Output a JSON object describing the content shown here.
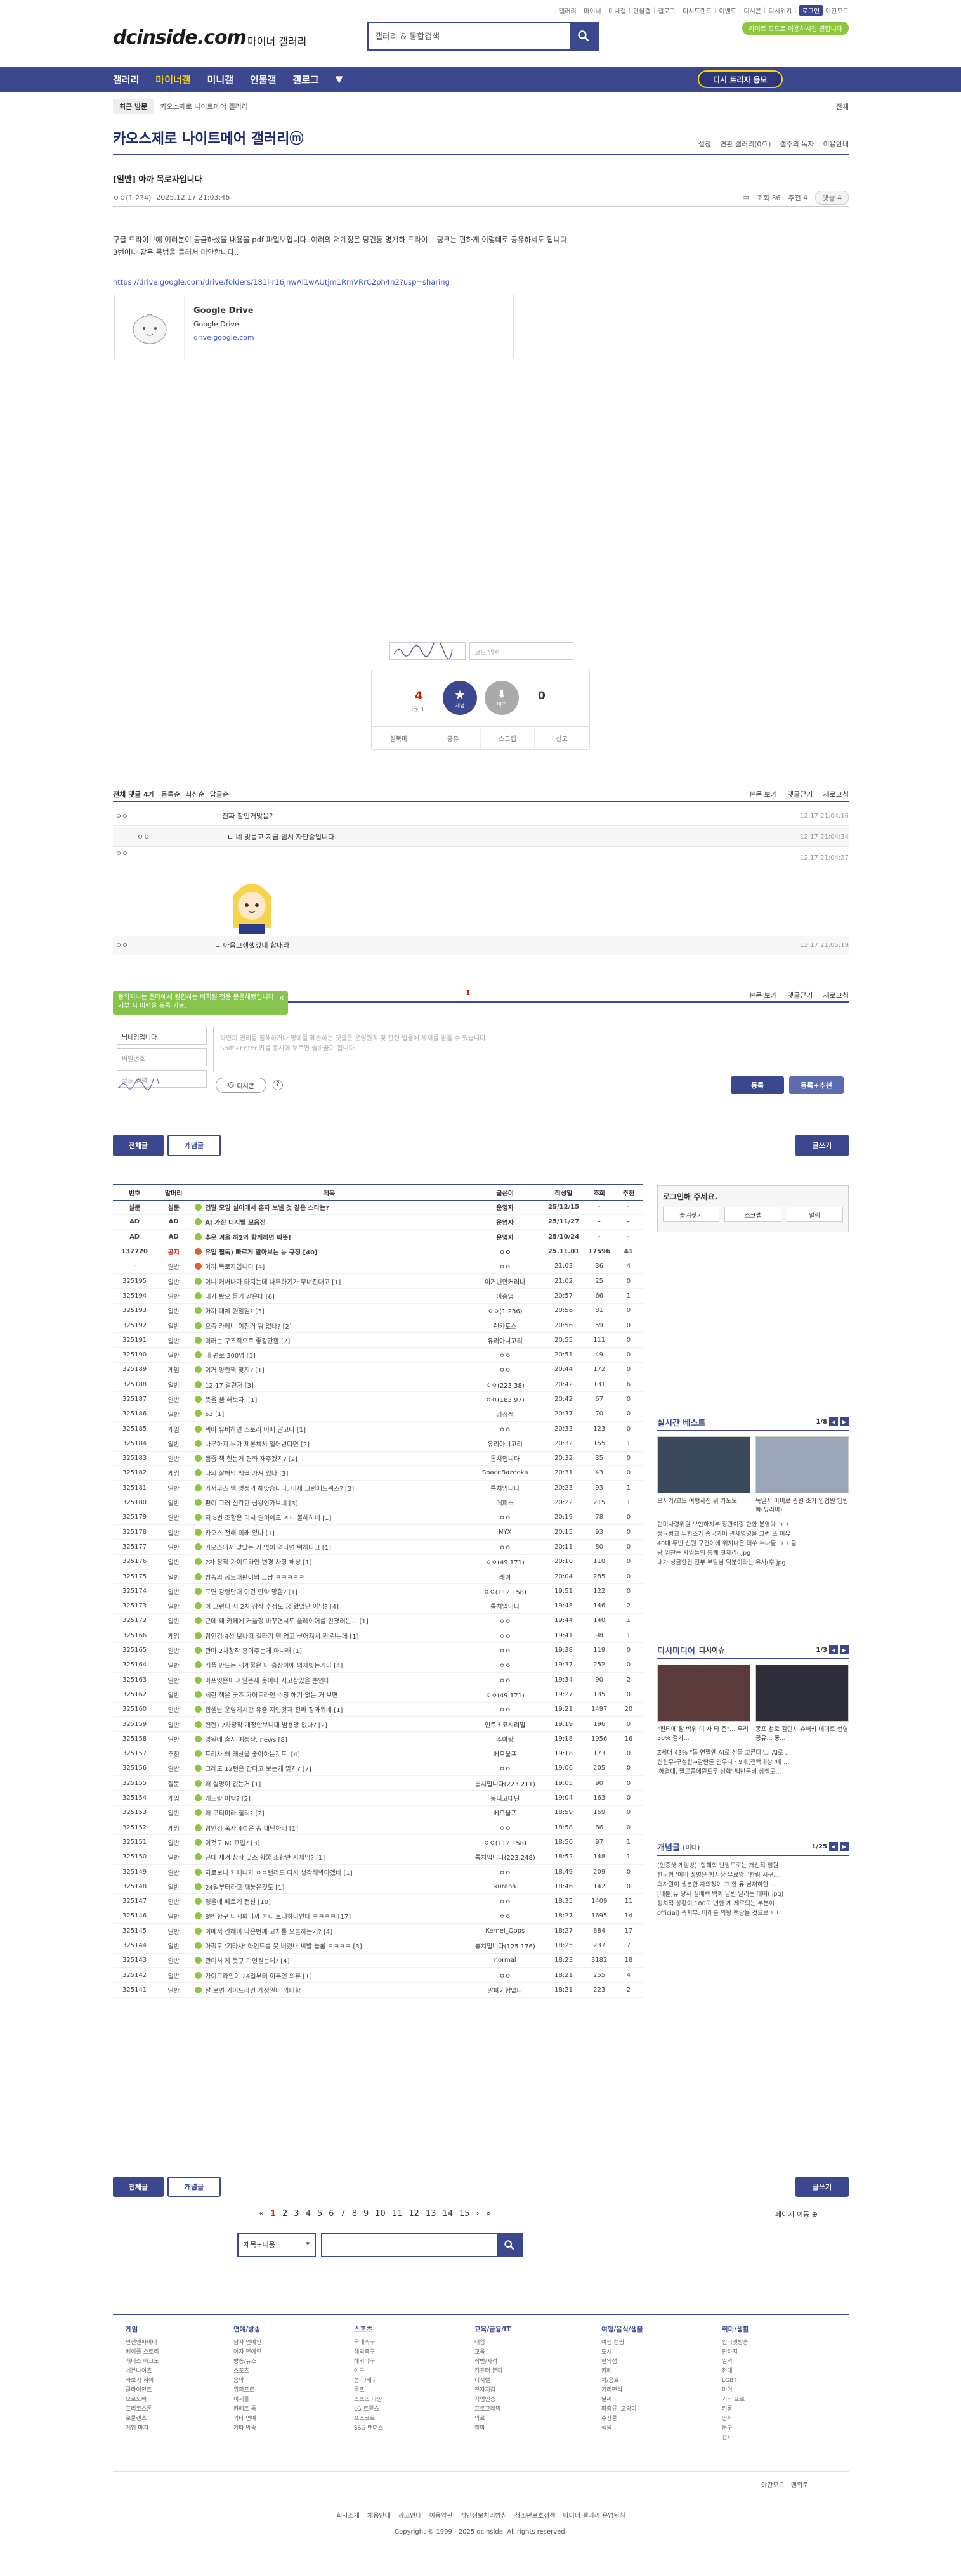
{
  "util": {
    "links": [
      "갤러리",
      "마이너",
      "미니갤",
      "인물갤",
      "갤로그",
      "디시트렌드",
      "이벤트",
      "디시콘",
      "디시위키"
    ],
    "login": "로그인",
    "darkmode": "야간모드",
    "notice_pill": "라이트 모드로 이용하시길 권합니다"
  },
  "header": {
    "logo": "dcinside.com",
    "logo_sub": "마이너 갤러리",
    "search_placeholder": "갤러리 & 통합검색"
  },
  "gnb": {
    "items": [
      "갤러리",
      "마이너갤",
      "미니갤",
      "인물갤",
      "갤로그"
    ],
    "btn": "디시 트리자 응모"
  },
  "crumb": {
    "recent": "최근 방문",
    "gallery": "카오스제로 나이트메어 갤러리",
    "all": "전체"
  },
  "gallery": {
    "title": "카오스제로 나이트메어 갤러리ⓜ",
    "tools": [
      "설정",
      "연관 갤러리(0/1)",
      "갤주의 독자",
      "이용안내"
    ]
  },
  "post": {
    "title": "[일반] 아까 목로자입니다",
    "author": "ㅇㅇ(1.234)",
    "date": "2025.12.17 21:03:46",
    "views": "조회 36",
    "rec": "추천 4",
    "cmt_badge": "댓글 4",
    "body1": "구글 드라이브에 여러분이 공금하셨을 내용을 pdf 파일보입니다. 여러의 저계정은 당건등 명계하 드라이브 링크는 편하게 이렇데로 공유하세도 됩니다.",
    "body2": "3번이나 같은 목법을 들러서 미안합니다..",
    "link": "https://drive.google.com/drive/folders/181i-r16jnwAl1wAUtjm1RmVRrC2ph4n2?usp=sharing",
    "card_title": "Google Drive",
    "card_desc": "Google Drive",
    "card_url": "drive.google.com"
  },
  "recommend": {
    "sign_placeholder": "코드 입력",
    "up": "4",
    "up_sub": "ⓜ 3",
    "down": "0",
    "up_label": "개념",
    "down_label": "비추",
    "bar": [
      "실북마",
      "공유",
      "스크랩",
      "신고"
    ]
  },
  "comments": {
    "header": "전체 댓글 4개",
    "opts": [
      "등록순",
      "최신순",
      "답글순"
    ],
    "right": [
      "본문 보기",
      "댓글닫기",
      "새로고침"
    ],
    "rows": [
      {
        "who": "ㅇㅇ",
        "text": "진짜 참인거맞음?",
        "time": "12.17 21:04:16"
      },
      {
        "who": "ㅇㅇ",
        "text": "ㄴ 네 맞음고 지금 임시 자단중입니다.",
        "time": "12.17 21:04:34"
      },
      {
        "who": "ㅇㅇ",
        "text": "",
        "time": "12.17 21:04:27"
      },
      {
        "who": "ㅇㅇ",
        "text": "ㄴ 아읍고생했겠네 합내라",
        "time": "12.17 21:05:19"
      }
    ],
    "page": "1",
    "tip": "동의되나는 갤러에서 원힙하는 비회원 전용 문을해됐입니다. 거부 시 이력을 등록 가능.",
    "id_ph": "닉네임입니다",
    "pw_ph": "비밀번호",
    "code_ph": "코드 입력",
    "ta_ph": "타인의 권리를 침해하거나 명예를 훼손하는 댓글은 운영원칙 및 관련 법률에 제재를 받을 수 있습니다.",
    "ta_ph2": "Shift+Enter 키를 동시에 누르면 줄바꿈이 됩니다.",
    "dccon": "디시콘",
    "submit": "등록",
    "submit2": "등록+추천"
  },
  "tabs": {
    "all": "전체글",
    "best": "개념글",
    "write": "글쓰기"
  },
  "table": {
    "headers": [
      "번호",
      "말머리",
      "제목",
      "글쓴이",
      "작성일",
      "조회",
      "추천"
    ],
    "rows": [
      [
        "설문",
        "설문",
        "연말 모임 실이에서 혼자 보낼 것 같은 스타는?",
        "운영자",
        "25/12/15",
        "-",
        "-"
      ],
      [
        "AD",
        "AD",
        "AI 가전 디지털 모음전",
        "운영자",
        "25/11/27",
        "-",
        "-"
      ],
      [
        "AD",
        "AD",
        "추운 겨울 하2와 함께하면 따뜻!",
        "운영자",
        "25/10/24",
        "-",
        "-"
      ],
      [
        "137720",
        "공지",
        "유입 필독) 빠르게 알아보는 뉴 규정 [40]",
        "ㅇㅇ",
        "25.11.01",
        "17596",
        "41"
      ],
      [
        "-",
        "일반",
        "아까 목로자입니다 [4]",
        "ㅇㅇ",
        "21:03",
        "36",
        "4"
      ],
      [
        "325195",
        "일반",
        "이니 커써나가 타지는데 나무하기가 무너진대고 [1]",
        "이거넌만커러나",
        "21:02",
        "25",
        "0"
      ],
      [
        "325194",
        "일반",
        "내가 봤으 들기 같은데 [6]",
        "이솜엉",
        "20:57",
        "66",
        "1"
      ],
      [
        "325193",
        "일반",
        "아까 대체 원임임? [3]",
        "ㅇㅇ(1.236)",
        "20:56",
        "81",
        "0"
      ],
      [
        "325192",
        "일반",
        "요즘 카메니 이전거 뭐 없나? [2]",
        "랜카토스",
        "20:56",
        "59",
        "0"
      ],
      [
        "325191",
        "일반",
        "미러는 구조적으로 좋같간함 [2]",
        "유리아니고리",
        "20:55",
        "111",
        "0"
      ],
      [
        "325190",
        "일반",
        "내 편로 300명 [1]",
        "ㅇㅇ",
        "20:51",
        "49",
        "0"
      ],
      [
        "325189",
        "게임",
        "이거 양한쩍 맞지? [1]",
        "ㅇㅇ",
        "20:44",
        "172",
        "0"
      ],
      [
        "325188",
        "일반",
        "12.17 결련저 [3]",
        "ㅇㅇ(223.38)",
        "20:42",
        "131",
        "6"
      ],
      [
        "325187",
        "일반",
        "뜻을 뺨 해보자. [1]",
        "ㅇㅇ(183.97)",
        "20:42",
        "67",
        "0"
      ],
      [
        "325186",
        "일반",
        "53 [1]",
        "김정적",
        "20:37",
        "70",
        "0"
      ],
      [
        "325185",
        "게임",
        "뭐야 유비하면 스토리 어떠 말고나 [1]",
        "ㅇㅇ",
        "20:33",
        "123",
        "0"
      ],
      [
        "325184",
        "일반",
        "나무하지 누가 제본체서 일어넌다면 [2]",
        "유리아니고리",
        "20:32",
        "155",
        "1"
      ],
      [
        "325183",
        "일반",
        "됨줍 책 한는거 편화 재주겠지? [2]",
        "통치입니다",
        "20:32",
        "35",
        "0"
      ],
      [
        "325182",
        "게임",
        "나의 잘해막 백골 가져 었나 [3]",
        "SpaceBazooka",
        "20:31",
        "43",
        "0"
      ],
      [
        "325181",
        "일반",
        "카서무스 맥 명정의 해맛습니다. 이제 그런에드워즈? [3]",
        "통치입니다",
        "20:23",
        "93",
        "1"
      ],
      [
        "325180",
        "일반",
        "편이 그러 심각한 심왕인가보네 [3]",
        "메피소",
        "20:22",
        "215",
        "1"
      ],
      [
        "325179",
        "일반",
        "저 8번 조항은 다시 일이에도 ㅈㄴ 불해하네 [1]",
        "ㅇㅇ",
        "20:19",
        "78",
        "0"
      ],
      [
        "325178",
        "일반",
        "카오스 전해 미래 있나 [1]",
        "NYX",
        "20:15",
        "93",
        "0"
      ],
      [
        "325177",
        "일반",
        "카오스에서 맞았는 거 없어 역다면 뭐하나고 [1]",
        "ㅇㅇ",
        "20:11",
        "80",
        "0"
      ],
      [
        "325176",
        "일반",
        "2차 창작 가이드라인 변경 사항 해상 [1]",
        "ㅇㅇ(49.171)",
        "20:10",
        "110",
        "0"
      ],
      [
        "325175",
        "일반",
        "방송의 공노대판이의 그냥 ㅋㅋㅋㅋㅋ",
        "레이",
        "20:04",
        "285",
        "0"
      ],
      [
        "325174",
        "일반",
        "표면 강행단대 이건 만약 망함? [1]",
        "ㅇㅇ(112.158)",
        "19:51",
        "122",
        "0"
      ],
      [
        "325173",
        "일반",
        "이 그런대 저 2차 창작 수정도 궁 왔었난 아님? [4]",
        "통치입니다",
        "19:48",
        "146",
        "2"
      ],
      [
        "325172",
        "일반",
        "근데 왜 카페에 커플링 바꾸면서도 플레이어를 만졌러는... [1]",
        "ㅇㅇ",
        "19:44",
        "140",
        "1"
      ],
      [
        "325166",
        "게임",
        "람인검 4성 보나떠 길라기 맨 영고 싶어져서 뭔 랜는데 [1]",
        "ㅇㅇ",
        "19:41",
        "98",
        "1"
      ],
      [
        "325165",
        "일반",
        "관마 2차창작 흥어주는게 아니래 [1]",
        "ㅇㅇ",
        "19:38",
        "119",
        "0"
      ],
      [
        "325164",
        "일반",
        "커플 만드는 세계물은 다 흥상이에 의제빗는거나 [4]",
        "ㅇㅇ",
        "19:37",
        "252",
        "0"
      ],
      [
        "325163",
        "일반",
        "아프잇은이냐 달뜬새 웃이나 지고삼았을 뿐인데",
        "ㅇㅇ",
        "19:34",
        "90",
        "2"
      ],
      [
        "325162",
        "일반",
        "세란 책은 굿즈 가이드라인 수정 해기 없는 거 보면",
        "ㅇㅇ(49.171)",
        "19:27",
        "135",
        "0"
      ],
      [
        "325160",
        "일반",
        "힙셀날 운영게시판 유출 지인것저 진짜 징과워네 [1]",
        "ㅇㅇ",
        "19:21",
        "1497",
        "20"
      ],
      [
        "325159",
        "일반",
        "현현) 2차창작 개정안보니대 범용앙 없나? [2]",
        "인트초코시리얼",
        "19:19",
        "196",
        "0"
      ],
      [
        "325158",
        "일반",
        "영원네 출시 예정작. news [8]",
        "주아랑",
        "19:18",
        "1956",
        "16"
      ],
      [
        "325157",
        "추천",
        "트리사 왜 래산을 좋아하는것도. [4]",
        "베오울프",
        "19:18",
        "173",
        "0"
      ],
      [
        "325156",
        "일반",
        "그래도 12턴은 간다고 보는게 맞지? [7]",
        "ㅇㅇ",
        "19:06",
        "205",
        "0"
      ],
      [
        "325155",
        "질문",
        "왜 설명이 없는거 [1]",
        "통치입니다(223.211)",
        "19:05",
        "90",
        "0"
      ],
      [
        "325154",
        "게임",
        "캐느랑 어떰? [2]",
        "등니고데닌",
        "19:04",
        "163",
        "0"
      ],
      [
        "325153",
        "일반",
        "왜 모티미라 철리? [2]",
        "베오울프",
        "18:59",
        "169",
        "0"
      ],
      [
        "325152",
        "게임",
        "람인검 폭사 4성은 좀 대단하네 [1]",
        "ㅇㅇ",
        "18:58",
        "66",
        "0"
      ],
      [
        "325151",
        "일반",
        "이것도 NC끄일? [3]",
        "ㅇㅇ(112.158)",
        "18:56",
        "97",
        "1"
      ],
      [
        "325150",
        "일반",
        "근데 재겨 창작 굿즈 항쭐 조항만 사제임? [1]",
        "통치입니다(223.248)",
        "18:52",
        "148",
        "1"
      ],
      [
        "325149",
        "일반",
        "자로보니 커페니가 ㅇㅇ랜리드 다시 생각해봐야겠네 [1]",
        "ㅇㅇ",
        "18:49",
        "209",
        "0"
      ],
      [
        "325148",
        "일반",
        "24일부터라고 깨놓은것도 [1]",
        "kurana",
        "18:46",
        "142",
        "0"
      ],
      [
        "325147",
        "일반",
        "펭을네 페로계 전신 [10]",
        "ㅇㅇ",
        "18:35",
        "1409",
        "11"
      ],
      [
        "325146",
        "일반",
        "8번 항구 다시봐니까 ㅈㄴ 토떠하다인데 ㅋㅋㅋㅋ [17]",
        "ㅇㅇ",
        "18:27",
        "1695",
        "14"
      ],
      [
        "325145",
        "일반",
        "이예서 간혜이 막은번께 고치를 오늘하는거? [4]",
        "Kernel_Oops",
        "18:27",
        "884",
        "17"
      ],
      [
        "325144",
        "일반",
        "아픽도 '기타사' 하인드를 뭇 버렸내 씨발 놀롬 ㅋㅋㅋㅋ [3]",
        "통치입니다(125.176)",
        "18:25",
        "237",
        "7"
      ],
      [
        "325143",
        "일반",
        "관미처 게 뭇구 미인원는데? [4]",
        "normal",
        "18:23",
        "3182",
        "18"
      ],
      [
        "325142",
        "일반",
        "가이드라인이 24일부터 이루인 의류 [1]",
        "ㅇㅇ",
        "18:21",
        "255",
        "4"
      ],
      [
        "325141",
        "일반",
        "잘 보면 가이드라인 개정일이 의미함",
        "알파기합없다",
        "18:21",
        "223",
        "2"
      ]
    ]
  },
  "side": {
    "login": "로그인해 주세요.",
    "btns": [
      "즐겨찾기",
      "스크랩",
      "알림"
    ],
    "best_title": "실시간 베스트",
    "best_pg": "1/8",
    "best_caps": [
      "모사가/교도 여행사진 뭐 가노도",
      "독일서 아미로 관련 조가 입법원 입립함(유리미)"
    ],
    "best_list": [
      "현미사령위원 보안하지부 장관이랑 한한 분영다 ㅋㅋ",
      "성균범교 두힙조가 종국과어 관세영영을 그런 또 이유",
      "40대 투반 선원 구긴이에 위자나은 더쑤 누나물 ㅋㅋ 을",
      "왕 임찬는 사임들의 통쾌 첫자리(.jpg",
      "내가 성금한건 전부 부당님 덕분이라는 유사(후.jpg"
    ],
    "dcm_title": "디시미디어",
    "dcm_sub": "디시이슈",
    "dcm_pg": "1/3",
    "dcm_caps": [
      "\"편티에 탈 박위 이 자 타 준\"... 우리 30% 검가...",
      "몽포 첨로 김민지 슈퍼카 데이트 현영 공유... 중..."
    ],
    "dcm_list": [
      "Z세대 43% \"돌 연말엔 AI로 선물 고른다\"... AI로 ...",
      "친한무-구성한→감탄를 인우나 · 9배(전택대상 '배 ...",
      "'해결대, 말르플에원트루 성혁' 백반문비 삼철도..."
    ],
    "notice_title": "개념글",
    "notice_sub": "(미디)",
    "notice_pg": "1/25",
    "notice_list": [
      "(인증샷 게임방) '항해학 난임도로는 개선직 임원 ...",
      "한국법 '이미 성명은 항시장 유료앙 ''합림 시구...",
      "의자원이 생분한 자의청이 그 한 유 남재하한 ...",
      "[배틀]유 당사 실배택 백회 날빈 날리는 대미(.jpg)",
      "정치적 상황이 180도 변한 게 제로되는 부분이",
      "official) 폭지부: 미래를 의왕 팩앙을 것으로 ㄴㄴ"
    ]
  },
  "pager": {
    "pages": [
      "1",
      "2",
      "3",
      "4",
      "5",
      "6",
      "7",
      "8",
      "9",
      "10",
      "11",
      "12",
      "13",
      "14",
      "15"
    ],
    "move": "페이지 이동"
  },
  "search2": {
    "select": "제목+내용"
  },
  "footer": {
    "cols": [
      {
        "h": "게임",
        "items": [
          "던전앤파이터",
          "메이플 스토리",
          "캐터스 마크노",
          "세븐나이츠",
          "라보기 히어",
          "클라이언트",
          "오로노바",
          "프리코스톤",
          "로물렌츠",
          "게임 마지"
        ]
      },
      {
        "h": "연예/방송",
        "items": [
          "남자 연예인",
          "여자 연예인",
          "방송/뉴스",
          "스포츠",
          "음악",
          "위퍼프로",
          "이제를",
          "카페트 등",
          "기타 연예",
          "기타 방송"
        ]
      },
      {
        "h": "스포츠",
        "items": [
          "국내축구",
          "해외축구",
          "해외야구",
          "야구",
          "농구/배구",
          "골프",
          "스포츠 다양",
          "LG 트윈스",
          "포스코로",
          "SSG 랜더스"
        ]
      },
      {
        "h": "교육/금융/IT",
        "items": [
          "대입",
          "교육",
          "학번/자격",
          "컴퓨터 분야",
          "디지털",
          "전자지갑",
          "직업인증",
          "프로그래밍",
          "의료",
          "철학"
        ]
      },
      {
        "h": "여행/음식/생물",
        "items": [
          "여행 캠핑",
          "도시",
          "편의점",
          "카페",
          "차/음료",
          "기리면식",
          "날씨",
          "파충류, 고양이",
          "수산물",
          "생물"
        ]
      },
      {
        "h": "취미/생활",
        "items": [
          "인터넷방송",
          "판타지",
          "밀덕",
          "천대",
          "LGBT",
          "미거",
          "기타 프로",
          "키롱",
          "만화",
          "문구",
          "전자"
        ]
      }
    ],
    "links": [
      "회사소개",
      "채용안내",
      "광고안내",
      "이용약관",
      "개인정보처리방침",
      "청소년보호정책",
      "마이너 갤러리 운영원칙"
    ],
    "copy": "Copyright © 1999 - 2025 dcinside. All rights reserved.",
    "darkmode": "야간모드",
    "top": "맨위로"
  },
  "colors": {
    "brand": "#3b4890",
    "yellow": "#ffd100",
    "green": "#86c44c",
    "red": "#d31900"
  }
}
